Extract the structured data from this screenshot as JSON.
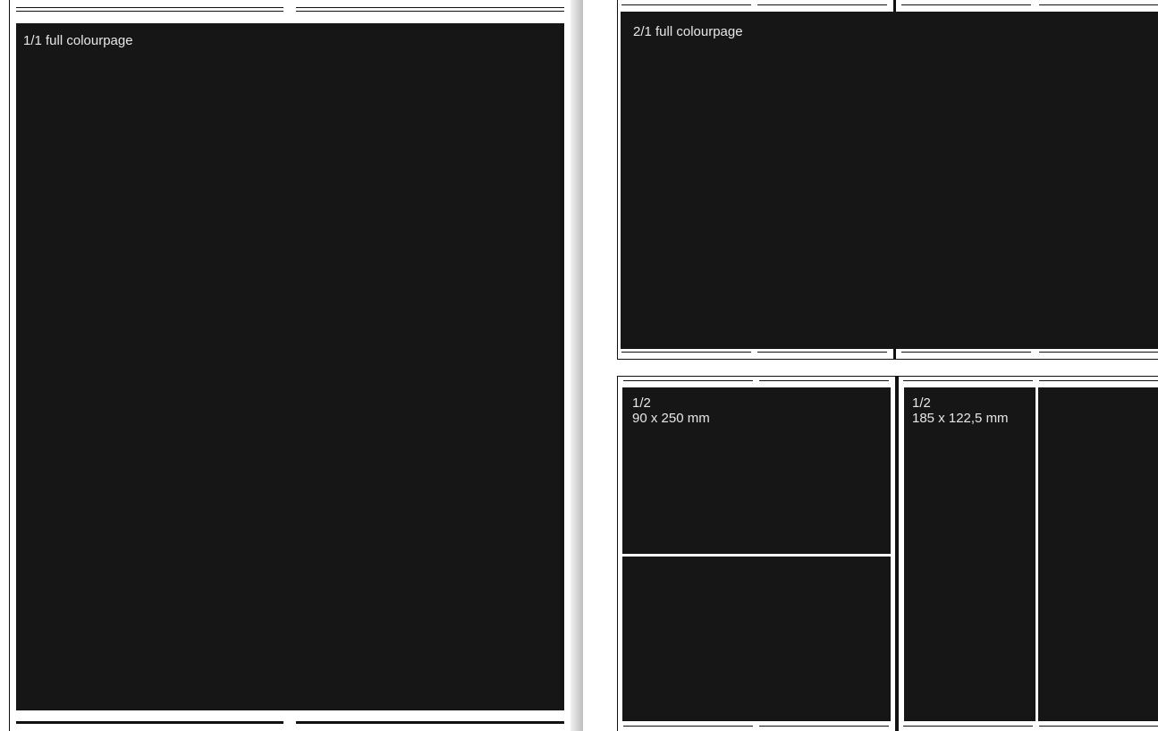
{
  "panels": {
    "full_page": {
      "label": "1/1 full colourpage"
    },
    "spread": {
      "label": "2/1 full colourpage"
    },
    "half_vertical": {
      "fraction": "1/2",
      "size": "90 x 250 mm"
    },
    "half_horizontal": {
      "fraction": "1/2",
      "size": "185 x 122,5 mm"
    }
  },
  "colors": {
    "ad_block": "#161616",
    "page": "#ffffff",
    "label_text": "#e6e6e6",
    "rules": "#111111"
  }
}
